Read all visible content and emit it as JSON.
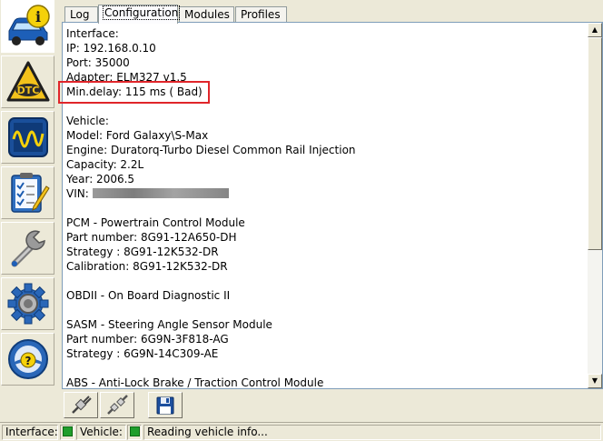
{
  "sidebar": {
    "items": [
      {
        "icon": "car-info-icon",
        "active": true
      },
      {
        "icon": "dtc-icon",
        "label": "DTC"
      },
      {
        "icon": "oscilloscope-icon"
      },
      {
        "icon": "checklist-icon"
      },
      {
        "icon": "wrench-icon"
      },
      {
        "icon": "gear-settings-icon"
      },
      {
        "icon": "help-steering-wheel-icon"
      }
    ]
  },
  "tabs": [
    {
      "label": "Log",
      "active": false
    },
    {
      "label": "Configuration",
      "active": true
    },
    {
      "label": "Modules",
      "active": false
    },
    {
      "label": "Profiles",
      "active": false
    }
  ],
  "content": {
    "interface_header": "Interface:",
    "ip": "IP: 192.168.0.10",
    "port": "Port: 35000",
    "adapter": "Adapter: ELM327 v1.5",
    "min_delay": "Min.delay: 115 ms ( Bad)",
    "vehicle_header": "Vehicle:",
    "model": "Model: Ford Galaxy\\S-Max",
    "engine": "Engine: Duratorq-Turbo Diesel Common Rail Injection",
    "capacity": "Capacity: 2.2L",
    "year": "Year: 2006.5",
    "vin_label": "VIN:",
    "pcm_title": "PCM - Powertrain Control Module",
    "pcm_part": "Part number: 8G91-12A650-DH",
    "pcm_strategy": "Strategy : 8G91-12K532-DR",
    "pcm_calibration": "Calibration: 8G91-12K532-DR",
    "obd_title": "OBDII - On Board Diagnostic II",
    "sasm_title": "SASM - Steering Angle Sensor Module",
    "sasm_part": "Part number: 6G9N-3F818-AG",
    "sasm_strategy": "Strategy : 6G9N-14C309-AE",
    "abs_title": "ABS - Anti-Lock Brake / Traction Control Module"
  },
  "toolbar": {
    "buttons": [
      {
        "icon": "connect-plug-icon"
      },
      {
        "icon": "disconnect-plug-icon"
      },
      {
        "icon": "save-disk-icon"
      }
    ]
  },
  "statusbar": {
    "interface_label": "Interface:",
    "vehicle_label": "Vehicle:",
    "status_text": "Reading vehicle info...",
    "led_color": "#1f9e2c"
  },
  "colors": {
    "highlight": "#e0252a",
    "background": "#ece9d8"
  }
}
